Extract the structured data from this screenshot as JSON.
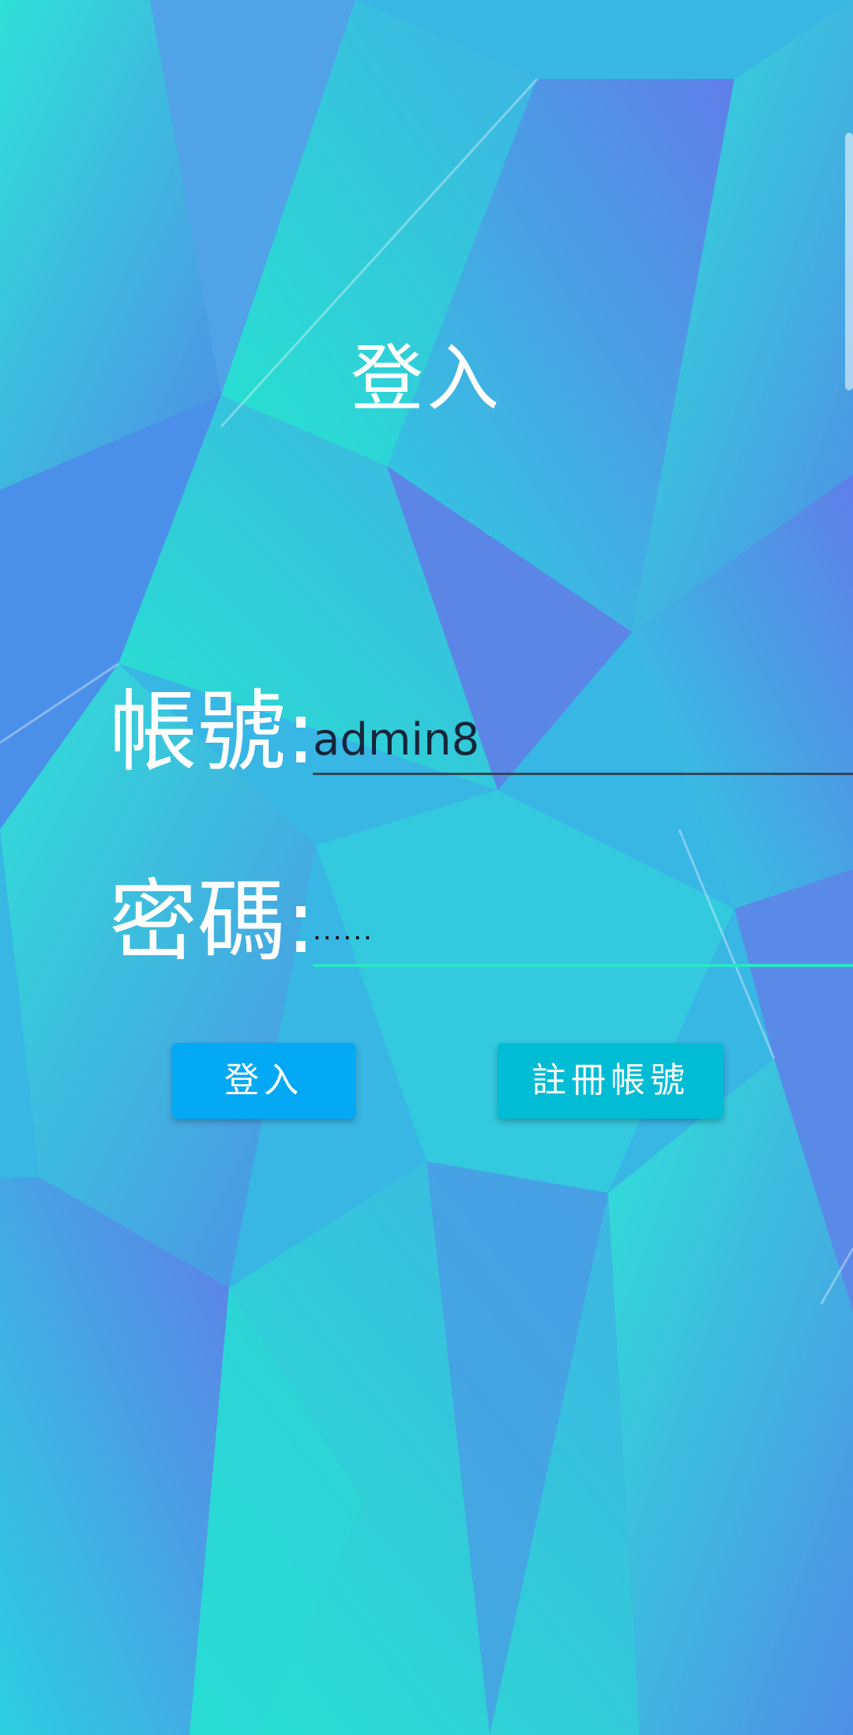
{
  "title": "登入",
  "form": {
    "account_label": "帳號:",
    "account_value": "admin8",
    "password_label": "密碼:",
    "password_value": "......"
  },
  "buttons": {
    "login_label": "登入",
    "register_label": "註冊帳號"
  },
  "colors": {
    "login_button": "#03A9F4",
    "register_button": "#00BCD4",
    "accent_underline": "#2DE3C9",
    "background_teal": "#22D6D6",
    "background_blue": "#5A86E8"
  }
}
